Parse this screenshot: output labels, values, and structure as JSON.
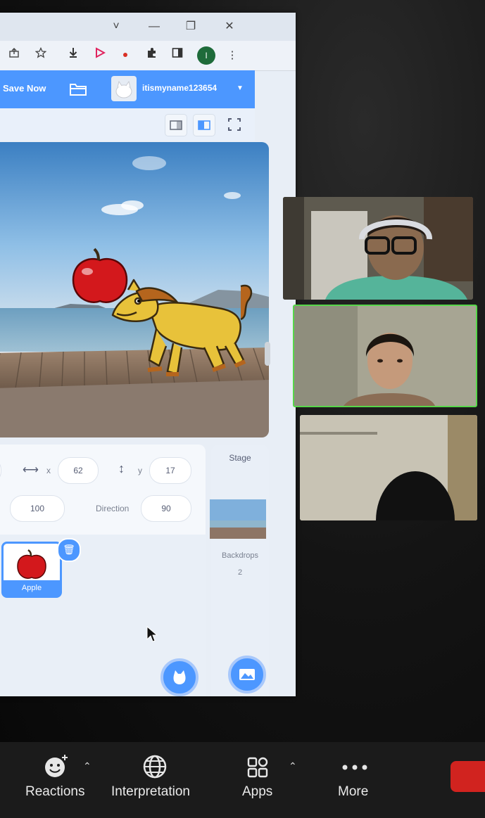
{
  "browser": {
    "title_controls": [
      "˅",
      "—",
      "❐",
      "✕"
    ],
    "toolbar_icons": [
      "share-icon",
      "star-icon",
      "download-icon",
      "play-extension-icon",
      "record-icon",
      "puzzle-icon",
      "sidebar-icon",
      "profile-icon",
      "menu-icon"
    ],
    "profile_initial": "I"
  },
  "scratch": {
    "save_now": "Save Now",
    "username": "itismyname123654",
    "sprite_info": {
      "x_label": "x",
      "x_value": "62",
      "y_label": "y",
      "y_value": "17",
      "size_value": "100",
      "direction_label": "Direction",
      "direction_value": "90"
    },
    "sprites": [
      {
        "name": "Apple",
        "selected": true
      }
    ],
    "stage_panel": {
      "title": "Stage",
      "backdrops_label": "Backdrops",
      "backdrops_count": "2"
    },
    "accent": "#4c97ff"
  },
  "meeting": {
    "active_speaker_border": "#57d64a",
    "toolbar": {
      "reactions": "Reactions",
      "interpretation": "Interpretation",
      "apps": "Apps",
      "more": "More"
    },
    "end_color": "#d1231f"
  }
}
